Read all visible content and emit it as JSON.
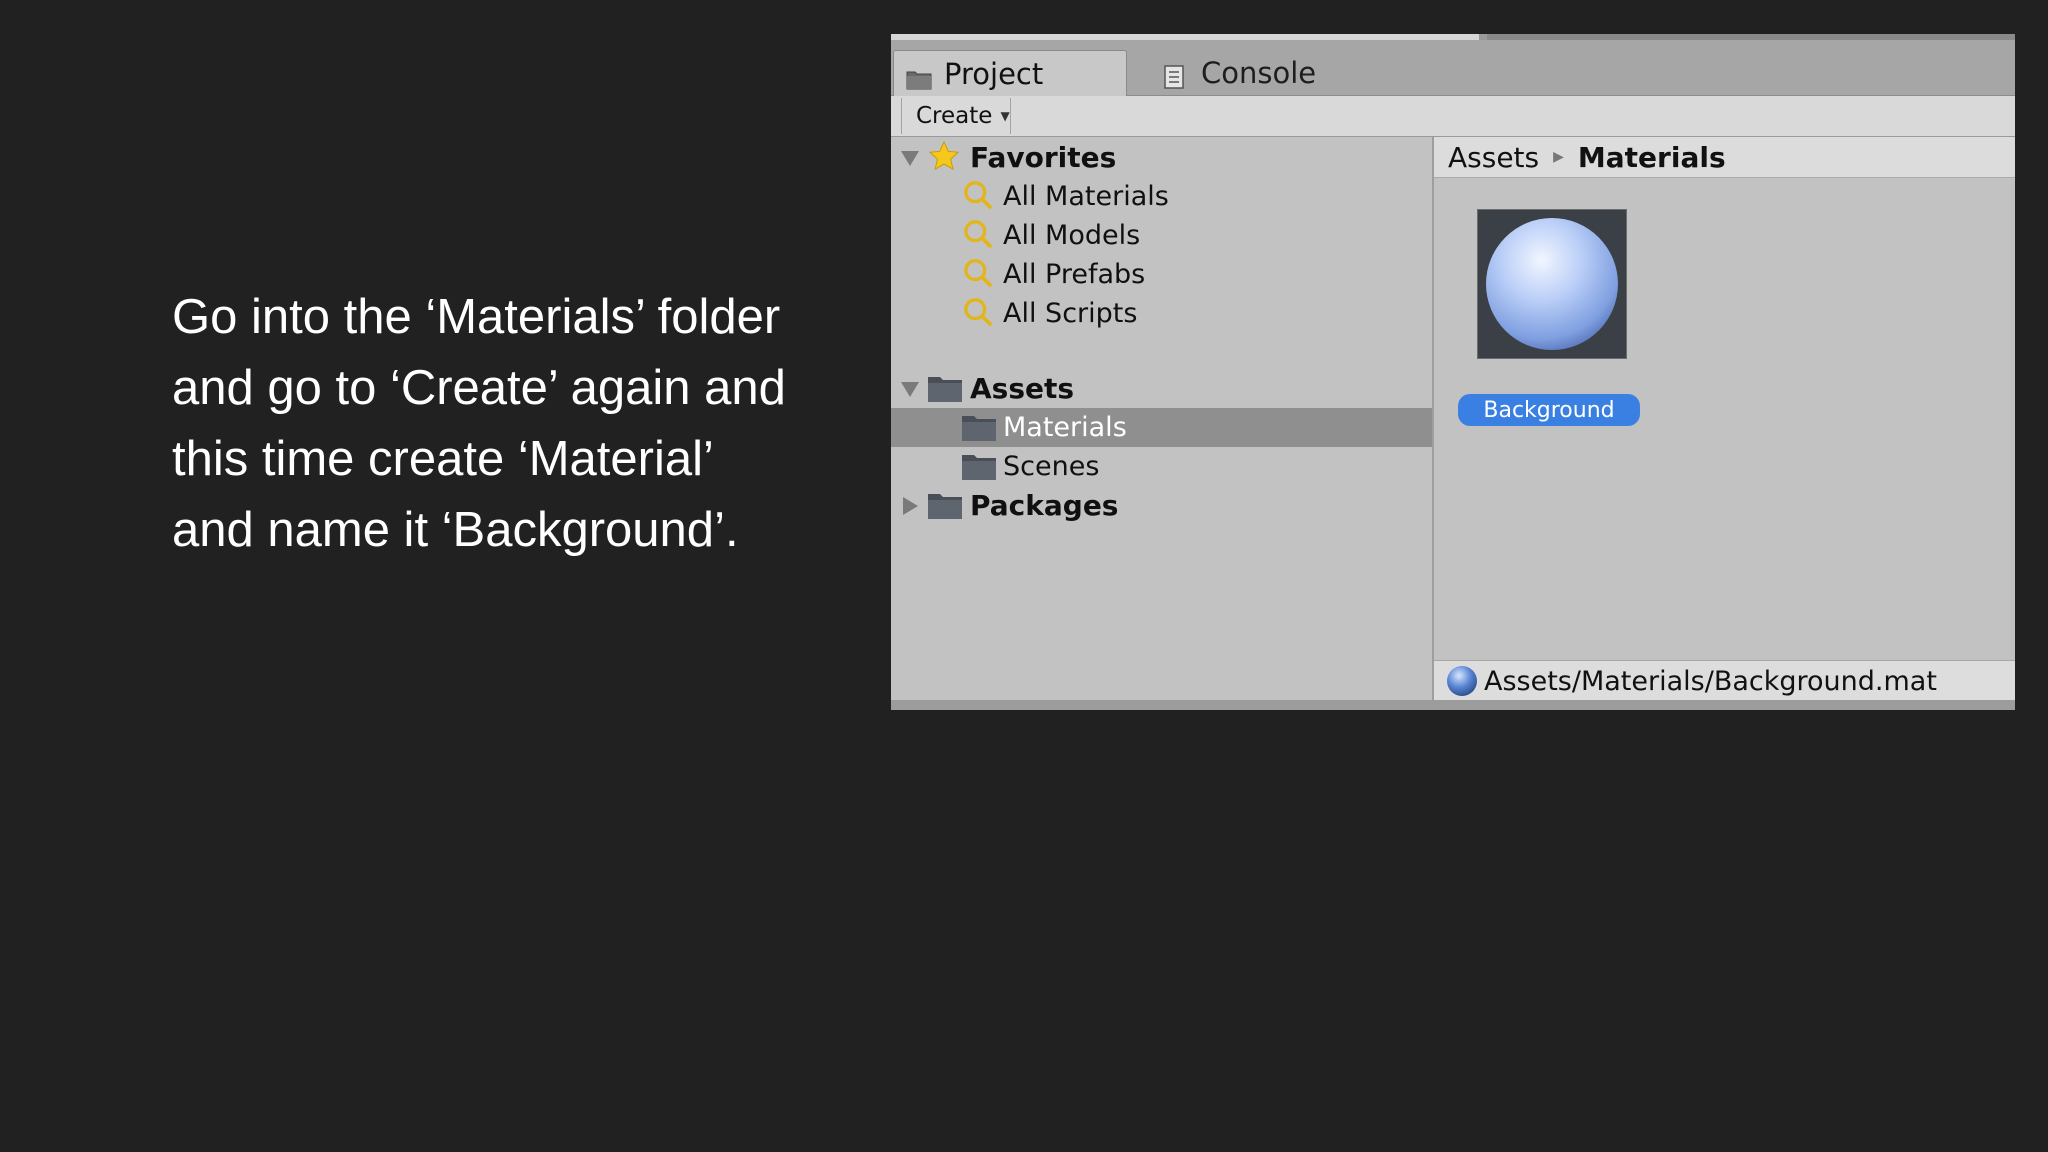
{
  "instruction": {
    "lines": [
      "Go into the ‘Materials’ folder",
      "and go to ‘Create’ again and",
      "this time create ‘Material’",
      "and name it ‘Background’."
    ]
  },
  "tabs": {
    "project": {
      "label": "Project",
      "icon": "folder-icon"
    },
    "console": {
      "label": "Console",
      "icon": "console-icon"
    }
  },
  "toolbar": {
    "create_label": "Create"
  },
  "tree": {
    "favorites": {
      "label": "Favorites",
      "items": [
        "All Materials",
        "All Models",
        "All Prefabs",
        "All Scripts"
      ]
    },
    "assets": {
      "label": "Assets",
      "children": [
        "Materials",
        "Scenes"
      ],
      "selected": "Materials"
    },
    "packages": {
      "label": "Packages"
    }
  },
  "breadcrumb": {
    "root": "Assets",
    "current": "Materials"
  },
  "asset": {
    "name": "Background",
    "icon": "material-sphere-icon"
  },
  "status": {
    "path": "Assets/Materials/Background.mat"
  },
  "colors": {
    "background": "#212121",
    "selection": "#3a80e3",
    "tree_selected": "#8f8f8f"
  }
}
